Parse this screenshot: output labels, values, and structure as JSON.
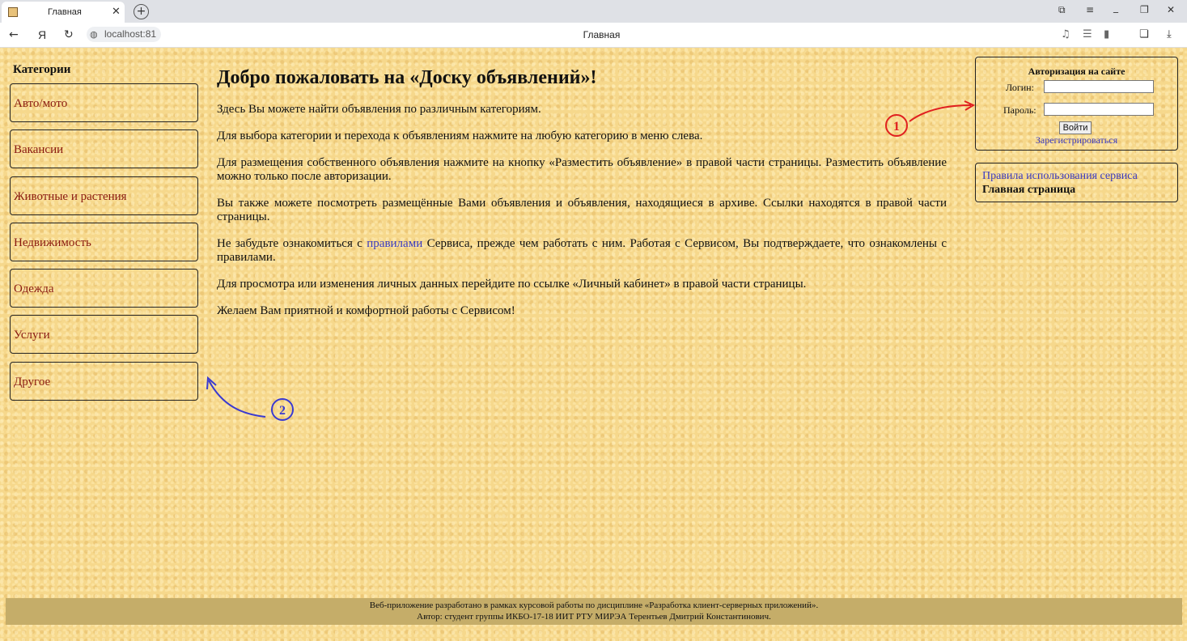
{
  "browser": {
    "tab_title": "Главная",
    "tab_close": "✕",
    "new_tab": "+",
    "url": "localhost:81",
    "page_title": "Главная",
    "window_controls": [
      "⧉",
      "≡",
      "_",
      "❐",
      "✕"
    ]
  },
  "sidebar": {
    "title": "Категории",
    "items": [
      {
        "label": "Авто/мото"
      },
      {
        "label": "Вакансии"
      },
      {
        "label": "Животные и растения"
      },
      {
        "label": "Недвижимость"
      },
      {
        "label": "Одежда"
      },
      {
        "label": "Услуги"
      },
      {
        "label": "Другое"
      }
    ]
  },
  "main": {
    "heading": "Добро пожаловать на «Доску объявлений»!",
    "p1": "Здесь Вы можете найти объявления по различным категориям.",
    "p2": "Для выбора категории и перехода к объявлениям нажмите на любую категорию в меню слева.",
    "p3": "Для размещения собственного объявления нажмите на кнопку «Разместить объявление» в правой части страницы. Разместить объявление можно только после авторизации.",
    "p4": "Вы также можете посмотреть размещённые Вами объявления и объявления, находящиеся в архиве. Ссылки находятся в правой части страницы.",
    "p5_before": "Не забудьте ознакомиться с ",
    "p5_link": "правилами",
    "p5_after": " Сервиса, прежде чем работать с ним. Работая с Сервисом, Вы подтверждаете, что ознакомлены с правилами.",
    "p6": "Для просмотра или изменения личных данных перейдите по ссылке «Личный кабинет» в правой части страницы.",
    "p7": "Желаем Вам приятной и комфортной работы с Сервисом!"
  },
  "auth": {
    "title": "Авторизация на сайте",
    "login_label": "Логин:",
    "password_label": "Пароль:",
    "login_value": "",
    "password_value": "",
    "submit_label": "Войти",
    "register_label": "Зарегистрироваться"
  },
  "links": {
    "rules": "Правила использования сервиса",
    "home": "Главная страница"
  },
  "footer": {
    "line1": "Веб-приложение разработано в рамках курсовой работы по дисциплине «Разработка клиент-серверных приложений».",
    "line2": "Автор: студент группы ИКБО-17-18 ИИТ РТУ МИРЭА Терентьев Дмитрий Константинович."
  },
  "annotations": {
    "marker1": "1",
    "marker2": "2",
    "marker1_color": "#e02020",
    "marker2_color": "#3a3ad0"
  },
  "colors": {
    "background": "#f6d88c",
    "footer": "#c5ad69",
    "category_text": "#8a1a10",
    "link": "#3a3ac0"
  }
}
